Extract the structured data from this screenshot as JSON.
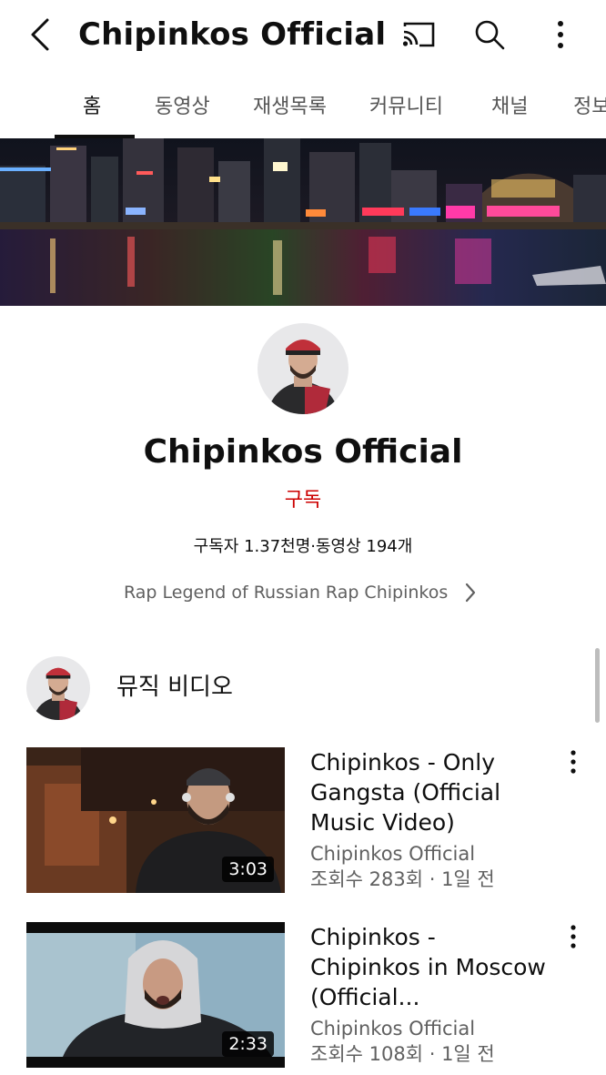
{
  "header": {
    "title": "Chipinkos Official",
    "back_icon": "chevron-left-icon",
    "cast_icon": "cast-icon",
    "search_icon": "search-icon",
    "more_icon": "more-vert-icon"
  },
  "tabs": [
    {
      "label": "홈",
      "active": true
    },
    {
      "label": "동영상",
      "active": false
    },
    {
      "label": "재생목록",
      "active": false
    },
    {
      "label": "커뮤니티",
      "active": false
    },
    {
      "label": "채널",
      "active": false
    },
    {
      "label": "정보",
      "active": false
    }
  ],
  "channel": {
    "name": "Chipinkos Official",
    "subscribe_label": "구독",
    "stats": "구독자 1.37천명·동영상 194개",
    "description": "Rap Legend of Russian Rap Chipinkos"
  },
  "section": {
    "title": "뮤직 비디오"
  },
  "videos": [
    {
      "title": "Chipinkos - Only Gangsta (Official Music Video)",
      "channel": "Chipinkos Official",
      "meta": "조회수 283회 · 1일 전",
      "duration": "3:03"
    },
    {
      "title": "Chipinkos - Chipinkos in Moscow (Official...",
      "channel": "Chipinkos Official",
      "meta": "조회수 108회 · 1일 전",
      "duration": "2:33"
    }
  ],
  "colors": {
    "subscribe": "#cc0000",
    "text_primary": "#0f0f0f",
    "text_secondary": "#606060"
  }
}
